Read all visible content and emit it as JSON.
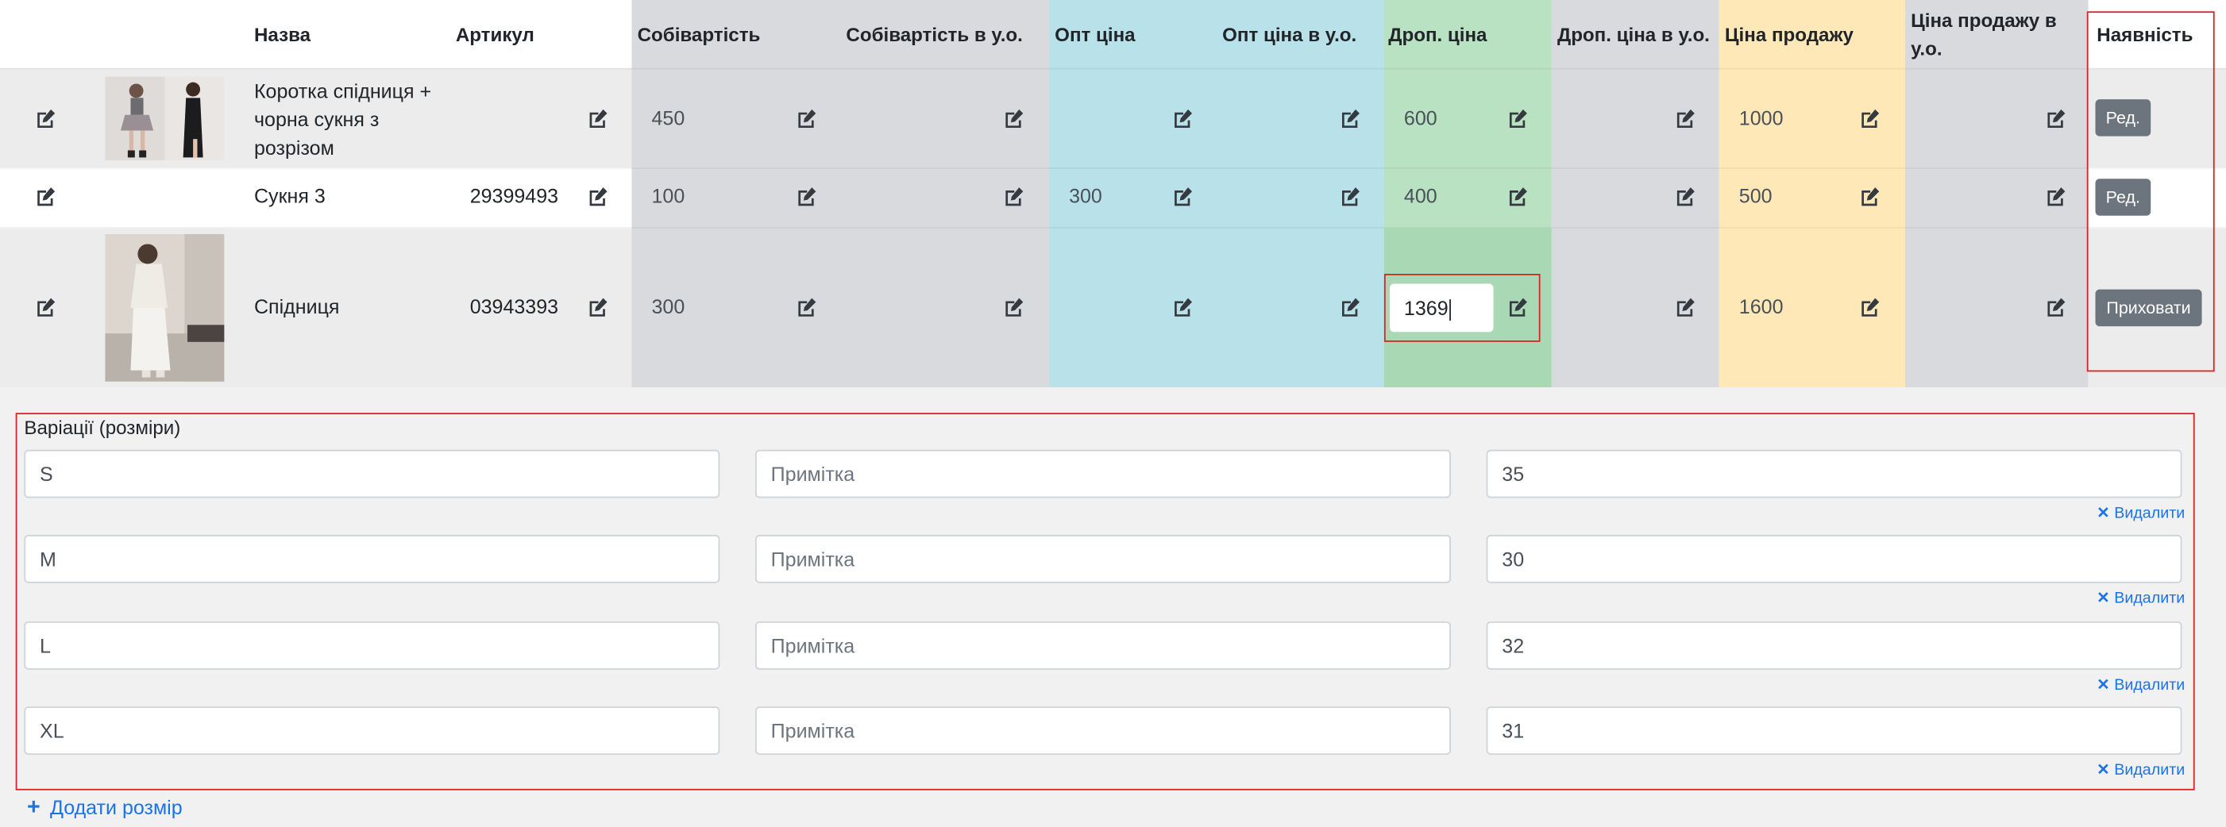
{
  "table": {
    "headers": {
      "name": "Назва",
      "article": "Артикул",
      "cost": "Собівартість",
      "cost_ue": "Собівартість в у.о.",
      "wholesale": "Опт ціна",
      "wholesale_ue": "Опт ціна в у.о.",
      "drop": "Дроп. ціна",
      "drop_ue": "Дроп. ціна в у.о.",
      "sale": "Ціна продажу",
      "sale_ue": "Ціна продажу в у.о.",
      "availability": "Наявність"
    },
    "rows": [
      {
        "name": "Коротка спідниця + чорна сукня з розрізом",
        "article": "",
        "cost": "450",
        "cost_ue": "",
        "wholesale": "",
        "wholesale_ue": "",
        "drop": "600",
        "drop_ue": "",
        "sale": "1000",
        "sale_ue": "",
        "action": "Ред."
      },
      {
        "name": "Сукня 3",
        "article": "29399493(",
        "cost": "100",
        "cost_ue": "",
        "wholesale": "300",
        "wholesale_ue": "",
        "drop": "400",
        "drop_ue": "",
        "sale": "500",
        "sale_ue": "",
        "action": "Ред."
      },
      {
        "name": "Спідниця",
        "article": "03943393",
        "cost": "300",
        "cost_ue": "",
        "wholesale": "",
        "wholesale_ue": "",
        "drop_input_value": "1369",
        "drop_ue": "",
        "sale": "1600",
        "sale_ue": "",
        "action": "Приховати"
      }
    ]
  },
  "variations": {
    "title": "Варіації (розміри)",
    "note_placeholder": "Примітка",
    "delete_label": "Видалити",
    "items": [
      {
        "size": "S",
        "qty": "35"
      },
      {
        "size": "M",
        "qty": "30"
      },
      {
        "size": "L",
        "qty": "32"
      },
      {
        "size": "XL",
        "qty": "31"
      }
    ],
    "add_label": "Додати розмір"
  },
  "colors": {
    "cost_bg": "#d9dadd",
    "wholesale_bg": "#b8e1ea",
    "drop_bg": "#b9e2c3",
    "drop_active_bg": "#a9d9b4",
    "sale_bg": "#ffe8b8",
    "row_alt_bg": "#ececec",
    "highlight": "#e02020",
    "link": "#1a73e8",
    "button": "#6c757d"
  },
  "icons": {
    "edit": "edit-icon",
    "close": "close-icon",
    "plus": "plus-icon"
  }
}
